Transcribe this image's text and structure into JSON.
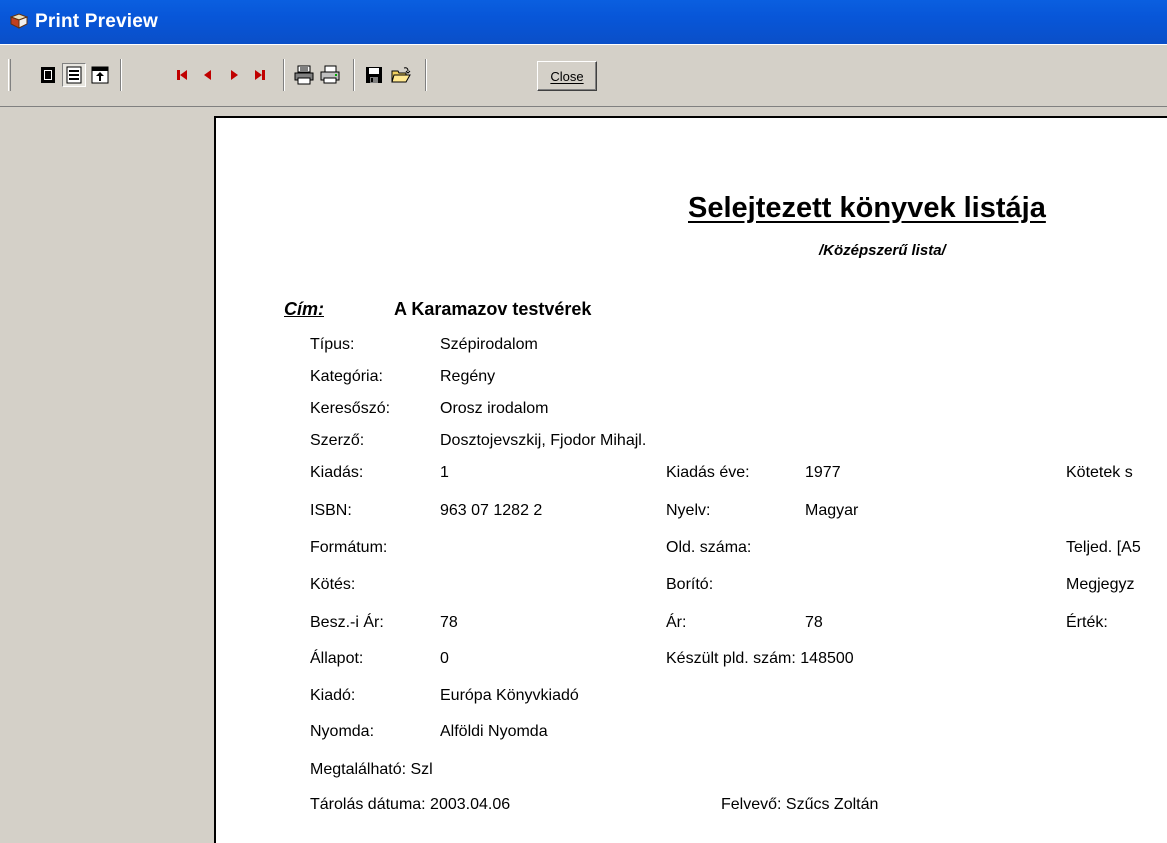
{
  "window": {
    "title": "Print Preview"
  },
  "toolbar": {
    "close_label": "Close",
    "icons": [
      "one-page-icon",
      "two-pages-icon",
      "zoom-icon",
      "first-page-icon",
      "prev-page-icon",
      "next-page-icon",
      "last-page-icon",
      "print-setup-icon",
      "print-icon",
      "save-icon",
      "open-icon"
    ]
  },
  "report": {
    "title": "Selejtezett könyvek listája",
    "subtitle": "/Középszerű lista/",
    "cim_label": "Cím:",
    "cim_value": "A Karamazov testvérek",
    "fields": {
      "tipus_label": "Típus:",
      "tipus_value": "Szépirodalom",
      "kategoria_label": "Kategória:",
      "kategoria_value": "Regény",
      "keresoszo_label": "Keresőszó:",
      "keresoszo_value": "Orosz irodalom",
      "szerzo_label": "Szerző:",
      "szerzo_value": "Dosztojevszkij, Fjodor Mihajl.",
      "kiadas_label": "Kiadás:",
      "kiadas_value": "1",
      "kiadas_eve_label": "Kiadás éve:",
      "kiadas_eve_value": "1977",
      "kotetek_label": "Kötetek s",
      "isbn_label": "ISBN:",
      "isbn_value": "963 07 1282 2",
      "nyelv_label": "Nyelv:",
      "nyelv_value": "Magyar",
      "formatum_label": "Formátum:",
      "old_szama_label": "Old. száma:",
      "teljed_label": "Teljed. [A5",
      "kotes_label": "Kötés:",
      "borito_label": "Borító:",
      "megjegyz_label": "Megjegyz",
      "beszar_label": "Besz.-i Ár:",
      "beszar_value": "78",
      "ar_label": "Ár:",
      "ar_value": "78",
      "ertek_label": "Érték:",
      "allapot_label": "Állapot:",
      "allapot_value": "0",
      "keszult_label": "Készült pld. szám: 148500",
      "kiado_label": "Kiadó:",
      "kiado_value": "Európa Könyvkiadó",
      "nyomda_label": "Nyomda:",
      "nyomda_value": "Alföldi Nyomda",
      "megtalalhato": "Megtalálható: Szl",
      "tarolas": "Tárolás dátuma: 2003.04.06",
      "felvevo": "Felvevő: Szűcs Zoltán"
    }
  }
}
